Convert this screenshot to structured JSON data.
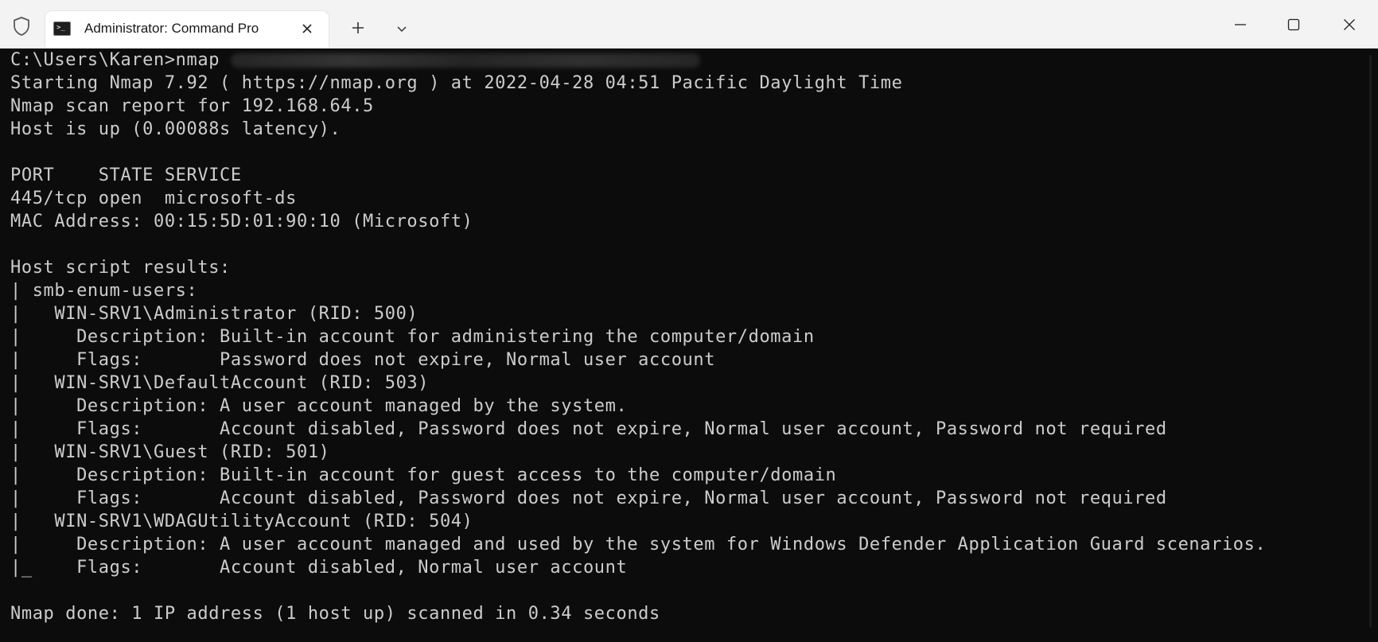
{
  "window": {
    "tab_title": "Administrator: Command Pro",
    "tab_icon_glyph": ">_",
    "new_tab_glyph": "+",
    "colors": {
      "titlebar_bg": "#f3f3f3",
      "tab_bg": "#ffffff",
      "terminal_bg": "#0c0c0c",
      "terminal_fg": "#cccccc"
    }
  },
  "icons": {
    "shield": "shield-icon",
    "close_tab": "close-icon",
    "new_tab": "plus-icon",
    "dropdown": "chevron-down-icon",
    "minimize": "minimize-icon",
    "maximize": "maximize-icon",
    "close_window": "close-icon"
  },
  "terminal": {
    "prompt": "C:\\Users\\Karen>nmap",
    "lines": [
      "Starting Nmap 7.92 ( https://nmap.org ) at 2022-04-28 04:51 Pacific Daylight Time",
      "Nmap scan report for 192.168.64.5",
      "Host is up (0.00088s latency).",
      "",
      "PORT    STATE SERVICE",
      "445/tcp open  microsoft-ds",
      "MAC Address: 00:15:5D:01:90:10 (Microsoft)",
      "",
      "Host script results:",
      "| smb-enum-users:",
      "|   WIN-SRV1\\Administrator (RID: 500)",
      "|     Description: Built-in account for administering the computer/domain",
      "|     Flags:       Password does not expire, Normal user account",
      "|   WIN-SRV1\\DefaultAccount (RID: 503)",
      "|     Description: A user account managed by the system.",
      "|     Flags:       Account disabled, Password does not expire, Normal user account, Password not required",
      "|   WIN-SRV1\\Guest (RID: 501)",
      "|     Description: Built-in account for guest access to the computer/domain",
      "|     Flags:       Account disabled, Password does not expire, Normal user account, Password not required",
      "|   WIN-SRV1\\WDAGUtilityAccount (RID: 504)",
      "|     Description: A user account managed and used by the system for Windows Defender Application Guard scenarios.",
      "|_    Flags:       Account disabled, Normal user account",
      "",
      "Nmap done: 1 IP address (1 host up) scanned in 0.34 seconds"
    ]
  }
}
